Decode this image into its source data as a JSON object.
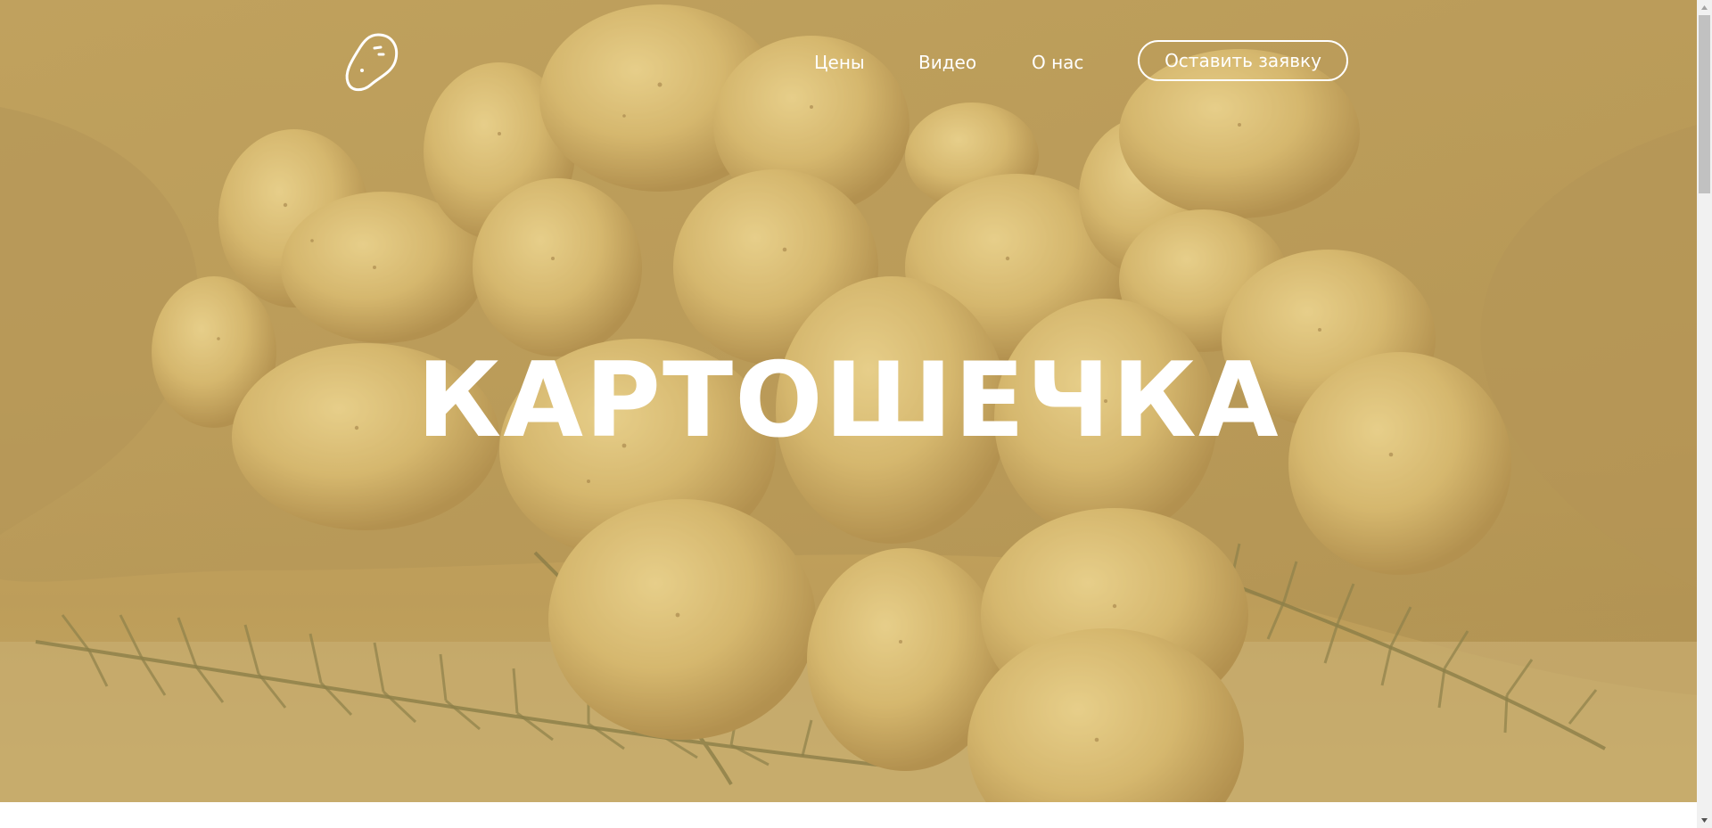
{
  "header": {
    "logo": "potato-logo-icon",
    "nav": [
      {
        "label": "Цены"
      },
      {
        "label": "Видео"
      },
      {
        "label": "О нас"
      }
    ],
    "cta_label": "Оставить заявку"
  },
  "hero": {
    "title": "КАРТОШЕЧКА",
    "background": "potatoes-in-burlap-sack-photo"
  },
  "colors": {
    "text": "#ffffff",
    "overlay": "#c9aa62"
  }
}
